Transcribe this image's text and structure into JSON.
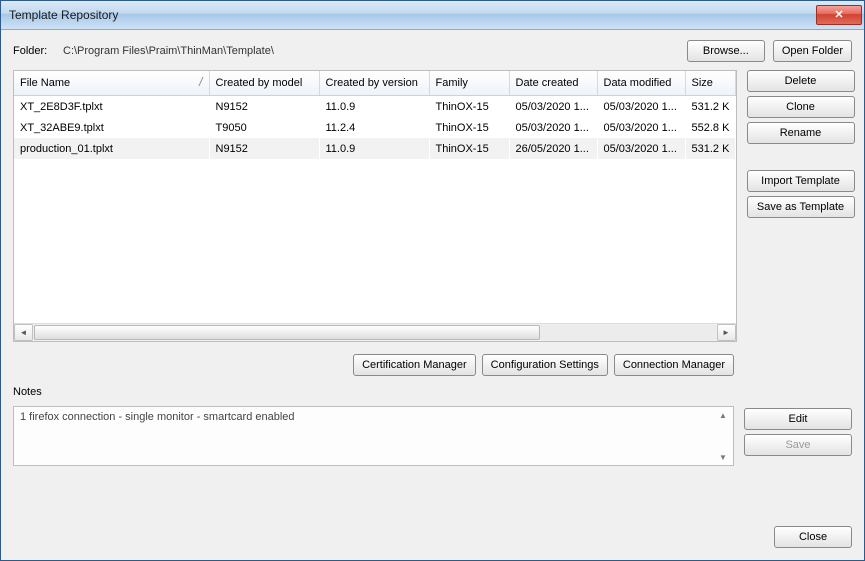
{
  "window": {
    "title": "Template Repository"
  },
  "folder": {
    "label": "Folder:",
    "path": "C:\\Program Files\\Praim\\ThinMan\\Template\\",
    "browse": "Browse...",
    "open": "Open Folder"
  },
  "table": {
    "headers": {
      "file": "File Name",
      "model": "Created by model",
      "version": "Created by version",
      "family": "Family",
      "created": "Date created",
      "modified": "Data modified",
      "size": "Size"
    },
    "rows": [
      {
        "file": "XT_2E8D3F.tplxt",
        "model": "N9152",
        "version": "11.0.9",
        "family": "ThinOX-15",
        "created": "05/03/2020 1...",
        "modified": "05/03/2020 1...",
        "size": "531.2 K",
        "sel": false
      },
      {
        "file": "XT_32ABE9.tplxt",
        "model": "T9050",
        "version": "11.2.4",
        "family": "ThinOX-15",
        "created": "05/03/2020 1...",
        "modified": "05/03/2020 1...",
        "size": "552.8 K",
        "sel": false
      },
      {
        "file": "production_01.tplxt",
        "model": "N9152",
        "version": "11.0.9",
        "family": "ThinOX-15",
        "created": "26/05/2020 1...",
        "modified": "05/03/2020 1...",
        "size": "531.2 K",
        "sel": true
      }
    ]
  },
  "side": {
    "delete": "Delete",
    "clone": "Clone",
    "rename": "Rename",
    "import": "Import Template",
    "saveas": "Save as Template"
  },
  "mid": {
    "cert": "Certification Manager",
    "conf": "Configuration Settings",
    "conn": "Connection Manager"
  },
  "notes": {
    "label": "Notes",
    "text": "1 firefox connection  - single monitor - smartcard enabled",
    "edit": "Edit",
    "save": "Save"
  },
  "footer": {
    "close": "Close"
  }
}
